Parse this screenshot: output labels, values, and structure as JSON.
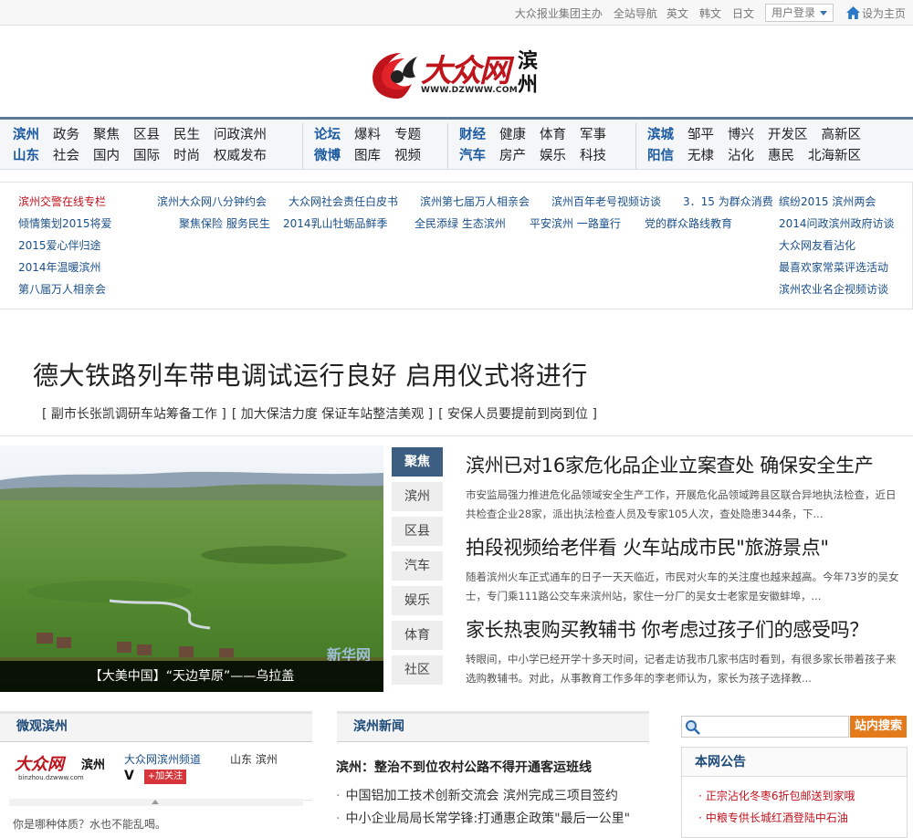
{
  "topbar": {
    "host": "大众报业集团主办",
    "nav": "全站导航",
    "lang_en": "英文",
    "lang_ko": "韩文",
    "lang_ja": "日文",
    "login": "用户登录",
    "set_home": "设为主页"
  },
  "logo": {
    "brand": "大众网",
    "url": "WWW.DZWWW.COM",
    "city": "滨州"
  },
  "nav": {
    "group1": {
      "row1": [
        "滨州",
        "政务",
        "聚焦",
        "区县",
        "民生",
        "问政滨州"
      ],
      "row2": [
        "山东",
        "社会",
        "国内",
        "国际",
        "时尚",
        "权威发布"
      ]
    },
    "group2": {
      "row1": [
        "论坛",
        "爆料",
        "专题"
      ],
      "row2": [
        "微博",
        "图库",
        "视频"
      ]
    },
    "group3": {
      "row1": [
        "财经",
        "健康",
        "体育",
        "军事"
      ],
      "row2": [
        "汽车",
        "房产",
        "娱乐",
        "科技"
      ]
    },
    "group4": {
      "row1": [
        "滨城",
        "邹平",
        "博兴",
        "开发区",
        "高新区"
      ],
      "row2": [
        "阳信",
        "无棣",
        "沾化",
        "惠民",
        "北海新区"
      ]
    }
  },
  "links": {
    "col1": [
      "滨州交警在线专栏",
      "倾情策划2015将爱",
      "2015爱心伴归途",
      "2014年温暖滨州",
      "第八届万人相亲会"
    ],
    "row1": [
      "滨州大众网八分钟约会",
      "大众网社会责任白皮书",
      "滨州第七届万人相亲会",
      "滨州百年老号视频访谈",
      "3．15 为群众消费"
    ],
    "row2": [
      "聚焦保险 服务民生",
      "2014乳山牡蛎品鲜季",
      "全民添绿 生态滨州",
      "平安滨州 一路童行",
      "党的群众路线教育"
    ],
    "col_right": [
      "缤纷2015 滨州两会",
      "2014问政滨州政府访谈",
      "大众网友看沾化",
      "最喜欢家常菜评选活动",
      "滨州农业名企视频访谈"
    ]
  },
  "headline": {
    "title": "德大铁路列车带电调试运行良好 启用仪式将进行",
    "subs": [
      "[ 副市长张凯调研车站筹备工作 ]",
      "[ 加大保洁力度 保证车站整洁美观 ]",
      "[ 安保人员要提前到岗到位 ]"
    ]
  },
  "photo": {
    "caption": "【大美中国】“天边草原”——乌拉盖",
    "watermark": "新华网"
  },
  "tabs": [
    "聚焦",
    "滨州",
    "区县",
    "汽车",
    "娱乐",
    "体育",
    "社区"
  ],
  "stories": [
    {
      "title": "滨州已对16家危化品企业立案查处 确保安全生产",
      "desc": "市安监局强力推进危化品领域安全生产工作，开展危化品领域跨县区联合异地执法检查，近日共检查企业28家，派出执法检查人员及专家105人次，查处隐患344条，下..."
    },
    {
      "title": "拍段视频给老伴看 火车站成市民\"旅游景点\"",
      "desc": "随着滨州火车正式通车的日子一天天临近，市民对火车的关注度也越来越高。今年73岁的吴女士，专门乘111路公交车来滨州站，家住一分厂的吴女士老家是安徽蚌埠，..."
    },
    {
      "title": "家长热衷购买教辅书 你考虑过孩子们的感受吗？",
      "desc": "转眼间，中小学已经开学十多天时间，记者走访我市几家书店时看到，有很多家长带着孩子来选购教辅书。对此，从事教育工作多年的李老师认为，家长为孩子选择教..."
    }
  ],
  "weibo": {
    "header": "微观滨州",
    "logo_brand": "大众网",
    "logo_city": "滨州",
    "logo_url": "binzhou.dzwww.com",
    "name": "大众网滨州频道",
    "location": "山东  滨州",
    "v": "V",
    "follow": "+加关注",
    "message": "你是哪种体质？水也不能乱喝。"
  },
  "bz_news": {
    "header": "滨州新闻",
    "top": "滨州：整治不到位农村公路不得开通客运班线",
    "items": [
      "中国铝加工技术创新交流会 滨州完成三项目签约",
      "中小企业局局长常学锋:打通惠企政策\"最后一公里\""
    ]
  },
  "search": {
    "placeholder": "",
    "button": "站内搜索"
  },
  "notice": {
    "header": "本网公告",
    "items": [
      "正宗沾化冬枣6折包邮送到家哦",
      "中粮专供长城红酒登陆中石油"
    ]
  },
  "colors": {
    "brand_red": "#c0141c",
    "nav_blue": "#1c5aa0",
    "tab_active": "#3c5e80",
    "search_btn": "#e37b1d"
  }
}
